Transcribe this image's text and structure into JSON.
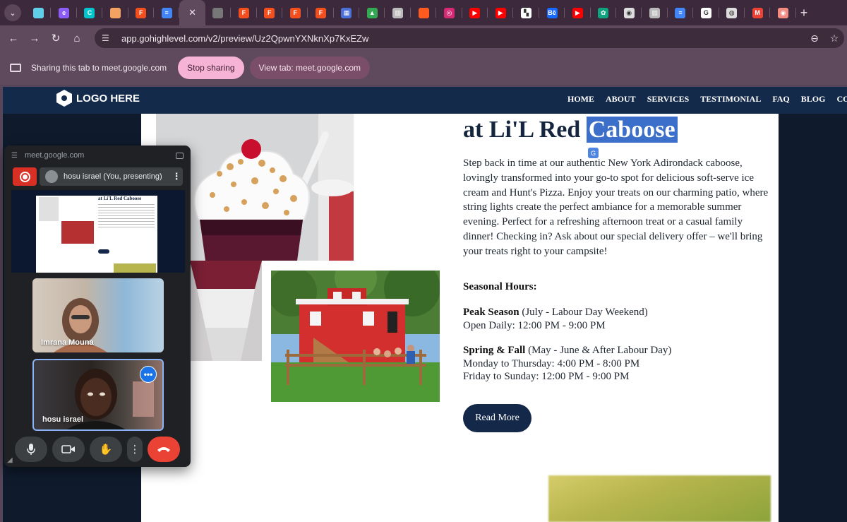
{
  "browser": {
    "tabs": [
      {
        "icon": "generic-app-icon",
        "color": "#5fd0e8",
        "letter": ""
      },
      {
        "icon": "eraser-icon",
        "color": "#8b5cf6",
        "letter": "e"
      },
      {
        "icon": "canva-icon",
        "color": "#00c4cc",
        "letter": "C"
      },
      {
        "icon": "orange-app-icon",
        "color": "#f4a261",
        "letter": ""
      },
      {
        "icon": "figma-icon",
        "color": "#f24e1e",
        "letter": "F"
      },
      {
        "icon": "google-docs-icon",
        "color": "#4285f4",
        "letter": "≡"
      },
      {
        "icon": "close-icon",
        "color": "",
        "letter": "✕",
        "active": true
      },
      {
        "icon": "loading-icon",
        "color": "#777",
        "letter": ""
      },
      {
        "icon": "figma-icon",
        "color": "#f24e1e",
        "letter": "F"
      },
      {
        "icon": "figma-icon",
        "color": "#f24e1e",
        "letter": "F"
      },
      {
        "icon": "figma-icon",
        "color": "#f24e1e",
        "letter": "F"
      },
      {
        "icon": "figma-icon",
        "color": "#f24e1e",
        "letter": "F"
      },
      {
        "icon": "calendar-icon",
        "color": "#4a6fd8",
        "letter": "▦"
      },
      {
        "icon": "google-drive-icon",
        "color": "#34a853",
        "letter": "▲"
      },
      {
        "icon": "analytics-icon",
        "color": "#bbb",
        "letter": "▥"
      },
      {
        "icon": "orange-square-icon",
        "color": "#ff5a1f",
        "letter": ""
      },
      {
        "icon": "instagram-icon",
        "color": "#d62976",
        "letter": "◎"
      },
      {
        "icon": "youtube-icon",
        "color": "#ff0000",
        "letter": "▶"
      },
      {
        "icon": "youtube-icon",
        "color": "#ff0000",
        "letter": "▶"
      },
      {
        "icon": "mondrian-icon",
        "color": "#ffffff",
        "letter": "▚"
      },
      {
        "icon": "behance-icon",
        "color": "#1769ff",
        "letter": "Bē"
      },
      {
        "icon": "youtube-icon",
        "color": "#ff0000",
        "letter": "▶"
      },
      {
        "icon": "chatgpt-icon",
        "color": "#10a37f",
        "letter": "✿"
      },
      {
        "icon": "circle-app-icon",
        "color": "#dddddd",
        "letter": "◉"
      },
      {
        "icon": "analytics-icon",
        "color": "#bbb",
        "letter": "▥"
      },
      {
        "icon": "google-docs-icon",
        "color": "#4285f4",
        "letter": "≡"
      },
      {
        "icon": "google-icon",
        "color": "#ffffff",
        "letter": "G"
      },
      {
        "icon": "chrome-icon",
        "color": "#dddddd",
        "letter": "◍"
      },
      {
        "icon": "gmail-icon",
        "color": "#ea4335",
        "letter": "M"
      },
      {
        "icon": "record-icon",
        "color": "#f28b82",
        "letter": "◉"
      }
    ],
    "url": "app.gohighlevel.com/v2/preview/Uz2QpwnYXNknXp7KxEZw"
  },
  "sharing": {
    "text": "Sharing this tab to meet.google.com",
    "stop_label": "Stop sharing",
    "view_label": "View tab: meet.google.com"
  },
  "site": {
    "logo_text": "LOGO HERE",
    "menu": [
      "HOME",
      "ABOUT",
      "SERVICES",
      "TESTIMONIAL",
      "FAQ",
      "BLOG",
      "CONTACT US"
    ],
    "headline_prefix": "at Li'L Red ",
    "headline_selected": "Caboose",
    "paragraph": "Step back in time at our authentic New York Adirondack caboose, lovingly transformed into your go-to spot for delicious soft-serve ice cream and Hunt's Pizza. Enjoy your treats on our charming patio, where string lights create the perfect ambiance for a memorable summer evening. Perfect for a refreshing afternoon treat or a casual family dinner! Checking in? Ask about our special delivery offer – we'll bring your treats right to your campsite!",
    "hours_title": "Seasonal Hours:",
    "peak_label": "Peak Season",
    "peak_range": " (July - Labour Day Weekend)",
    "peak_hours": "Open Daily: 12:00 PM - 9:00 PM",
    "spring_label": "Spring & Fall",
    "spring_range": " (May - June & After Labour Day)",
    "spring_weekday": "Monday to Thursday: 4:00 PM - 8:00 PM",
    "spring_weekend": "Friday to Sunday: 12:00 PM - 9:00 PM",
    "read_more": "Read More"
  },
  "meet": {
    "url": "meet.google.com",
    "presenter_label": "hosu israel (You, presenting)",
    "participants": [
      {
        "name": "Imrana Mouna"
      },
      {
        "name": "hosu israel"
      }
    ],
    "thumb_headline": "at Li'L Red Caboose"
  },
  "colors": {
    "nav_bg": "#132a4a",
    "accent_selection": "#3b6fc9",
    "button_bg": "#14284a",
    "stop_button": "#f6b3d5",
    "end_call": "#ea4335"
  }
}
